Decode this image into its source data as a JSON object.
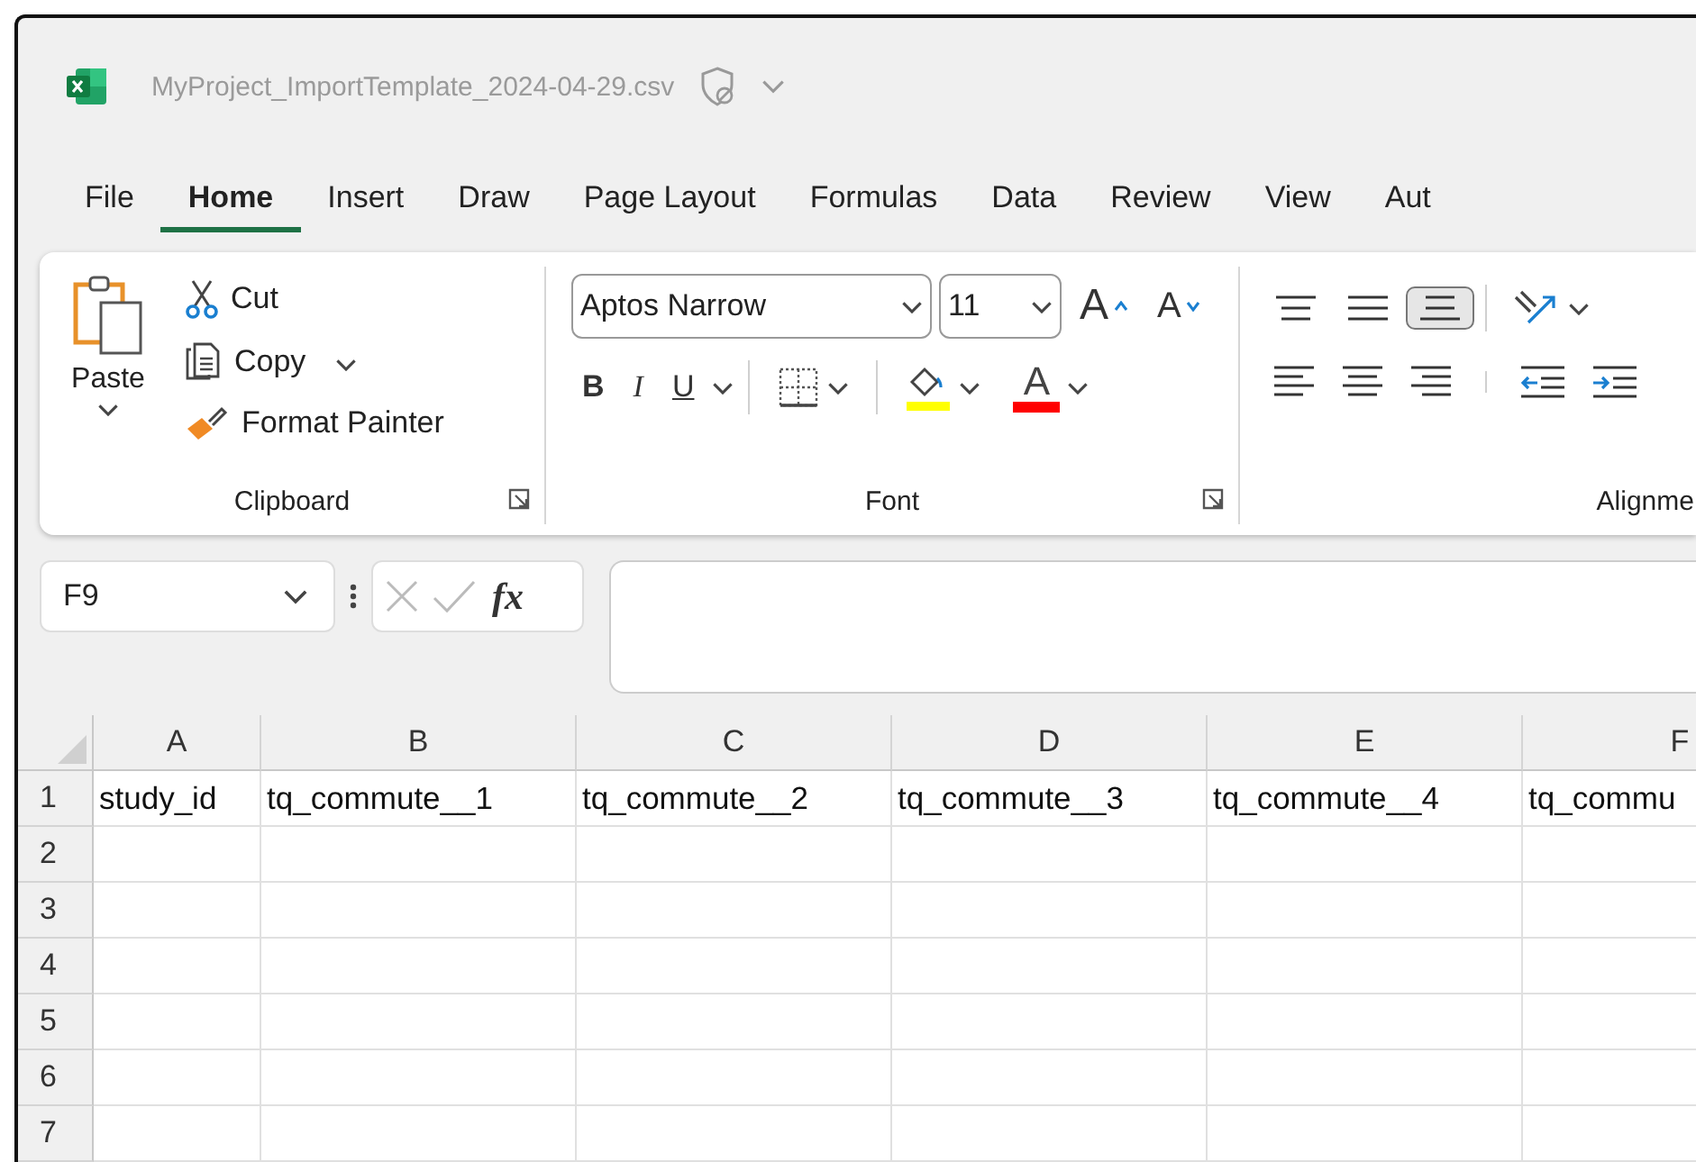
{
  "window": {
    "title": "MyProject_ImportTemplate_2024-04-29.csv"
  },
  "tabs": [
    {
      "label": "File",
      "selected": false
    },
    {
      "label": "Home",
      "selected": true
    },
    {
      "label": "Insert",
      "selected": false
    },
    {
      "label": "Draw",
      "selected": false
    },
    {
      "label": "Page Layout",
      "selected": false
    },
    {
      "label": "Formulas",
      "selected": false
    },
    {
      "label": "Data",
      "selected": false
    },
    {
      "label": "Review",
      "selected": false
    },
    {
      "label": "View",
      "selected": false
    },
    {
      "label": "Aut",
      "selected": false
    }
  ],
  "clipboard": {
    "paste": "Paste",
    "cut": "Cut",
    "copy": "Copy",
    "format_painter": "Format Painter",
    "label": "Clipboard"
  },
  "font": {
    "name": "Aptos Narrow",
    "size": "11",
    "grow": "A",
    "shrink": "A",
    "bold": "B",
    "italic": "I",
    "underline": "U",
    "font_color": "A",
    "label": "Font"
  },
  "alignment": {
    "label": "Alignme",
    "vertical": [
      {
        "kind": "top",
        "selected": false
      },
      {
        "kind": "middle",
        "selected": false
      },
      {
        "kind": "bottom",
        "selected": true
      }
    ]
  },
  "name_box": "F9",
  "fx": "fx",
  "sheet": {
    "columns": [
      "A",
      "B",
      "C",
      "D",
      "E",
      "F"
    ],
    "rows": [
      {
        "number": "1",
        "cells": [
          "study_id",
          "tq_commute__1",
          "tq_commute__2",
          "tq_commute__3",
          "tq_commute__4",
          "tq_commu"
        ]
      },
      {
        "number": "2"
      },
      {
        "number": "3"
      },
      {
        "number": "4"
      },
      {
        "number": "5"
      },
      {
        "number": "6"
      },
      {
        "number": "7"
      }
    ]
  }
}
